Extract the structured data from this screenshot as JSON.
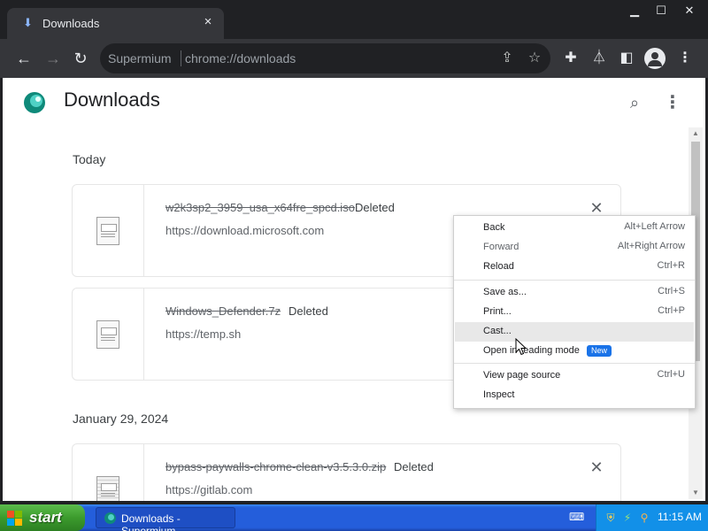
{
  "browser": {
    "tab_title": "Downloads",
    "omnibox_site": "Supermium",
    "omnibox_url": "chrome://downloads"
  },
  "page": {
    "title": "Downloads",
    "groups": [
      {
        "date": "Today",
        "items": [
          {
            "filename": "w2k3sp2_3959_usa_x64fre_spcd.iso",
            "status": "Deleted",
            "url": "https://download.microsoft.com"
          },
          {
            "filename": "Windows_Defender.7z",
            "status": "Deleted",
            "url": "https://temp.sh"
          }
        ]
      },
      {
        "date": "January 29, 2024",
        "items": [
          {
            "filename": "bypass-paywalls-chrome-clean-v3.5.3.0.zip",
            "status": "Deleted",
            "url": "https://gitlab.com"
          }
        ]
      }
    ]
  },
  "context_menu": {
    "items": [
      {
        "label": "Back",
        "shortcut": "Alt+Left Arrow"
      },
      {
        "label": "Forward",
        "shortcut": "Alt+Right Arrow"
      },
      {
        "label": "Reload",
        "shortcut": "Ctrl+R"
      },
      {
        "label": "Save as...",
        "shortcut": "Ctrl+S"
      },
      {
        "label": "Print...",
        "shortcut": "Ctrl+P"
      },
      {
        "label": "Cast...",
        "shortcut": ""
      },
      {
        "label": "Open in reading mode",
        "shortcut": "",
        "badge": "New"
      },
      {
        "label": "View page source",
        "shortcut": "Ctrl+U"
      },
      {
        "label": "Inspect",
        "shortcut": ""
      }
    ],
    "highlighted": "Cast..."
  },
  "taskbar": {
    "start_label": "start",
    "task_label": "Downloads - Supermium",
    "clock": "11:15 AM"
  },
  "icons": {
    "tab": "download-icon",
    "back": "arrow-left-icon",
    "forward": "arrow-right-icon",
    "reload": "reload-icon",
    "share": "share-icon",
    "bookmark": "star-icon",
    "extensions": "puzzle-icon",
    "labs": "flask-icon",
    "side_panel": "side-panel-icon",
    "profile": "avatar-icon"
  }
}
